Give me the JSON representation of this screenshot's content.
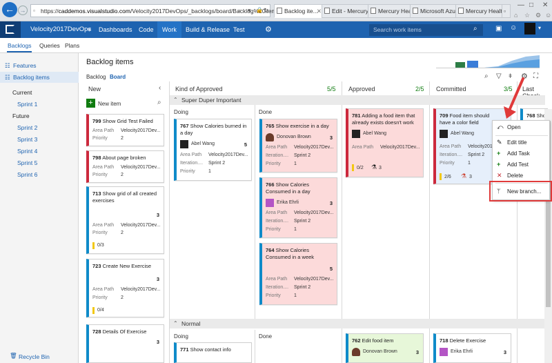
{
  "browser": {
    "url_prefix": "https://",
    "url_host": "caddemos.visualstudio.com",
    "url_path": "/Velocity2017DevOps/_backlogs/board/Backlog%20items",
    "tabs": [
      "Backlog ite...",
      "Edit - Mercury ...",
      "Mercury Healt...",
      "Microsoft Azur...",
      "Mercury Healt..."
    ],
    "window_controls": [
      "—",
      "□",
      "✕"
    ]
  },
  "topnav": {
    "project": "Velocity2017DevOps",
    "items": [
      "Dashboards",
      "Code",
      "Work",
      "Build & Release",
      "Test"
    ],
    "search_placeholder": "Search work items"
  },
  "subnav": {
    "items": [
      "Backlogs",
      "Queries",
      "Plans"
    ]
  },
  "left": {
    "features": "Features",
    "backlog_items": "Backlog items",
    "current": "Current",
    "sprint1": "Sprint 1",
    "future": "Future",
    "future_sprints": [
      "Sprint 2",
      "Sprint 3",
      "Sprint 4",
      "Sprint 5",
      "Sprint 6"
    ],
    "recycle_bin": "Recycle Bin"
  },
  "board": {
    "title": "Backlog items",
    "view_tabs": [
      "Backlog",
      "Board"
    ],
    "columns": [
      {
        "name": "New"
      },
      {
        "name": "Kind of Approved",
        "count": "5/5"
      },
      {
        "name": "Approved",
        "count": "2/5"
      },
      {
        "name": "Committed",
        "count": "3/5"
      },
      {
        "name": "Last Check"
      }
    ],
    "new_item": "New item",
    "swimlanes": [
      "Super Duper Important",
      "Normal"
    ],
    "lanes": [
      "Doing",
      "Done"
    ]
  },
  "labels": {
    "area": "Area Path",
    "priority": "Priority",
    "iteration": "Iteration...."
  },
  "cards": {
    "c799": {
      "id": "799",
      "title": "Show Grid Test Failed",
      "area": "Velocity2017Dev...",
      "priority": "2"
    },
    "c798": {
      "id": "798",
      "title": "About page broken",
      "area": "Velocity2017Dev...",
      "priority": "2"
    },
    "c713": {
      "id": "713",
      "title": "Show grid of all created exercises",
      "est": "3",
      "area": "Velocity2017Dev...",
      "priority": "2",
      "tasks": "0/3"
    },
    "c723": {
      "id": "723",
      "title": "Create New Exercise",
      "est": "3",
      "area": "Velocity2017Dev...",
      "priority": "2",
      "tasks": "0/4"
    },
    "c728": {
      "id": "728",
      "title": "Details Of Exercise",
      "est": "3"
    },
    "c767": {
      "id": "767",
      "title": "Show Calories burned in a day",
      "user": "Abel Wang",
      "est": "5",
      "area": "Velocity2017Dev...",
      "iteration": "Sprint 2",
      "priority": "1"
    },
    "c765": {
      "id": "765",
      "title": "Show exercise in a day",
      "user": "Donovan Brown",
      "est": "3",
      "area": "Velocity2017Dev...",
      "iteration": "Sprint 2",
      "priority": "1"
    },
    "c766": {
      "id": "766",
      "title": "Show Calories Consumed in a day",
      "user": "Erika Ehrli",
      "est": "3",
      "area": "Velocity2017Dev...",
      "iteration": "Sprint 2",
      "priority": "1"
    },
    "c764": {
      "id": "764",
      "title": "Show Calories Consumed in a week",
      "est": "5",
      "area": "Velocity2017Dev...",
      "iteration": "Sprint 2",
      "priority": "1"
    },
    "c781": {
      "id": "781",
      "title": "Adding a food item that already exists doesn't work",
      "user": "Abel Wang",
      "area": "Velocity2017Dev...",
      "tasks": "0/2",
      "tests": "3"
    },
    "c709": {
      "id": "709",
      "title": "Food item should have a color field",
      "user": "Abel Wang",
      "area": "Velocity2017D",
      "iteration": "Sprint 2",
      "priority": "1",
      "tasks": "2/6",
      "tests": "3"
    },
    "c768": {
      "id": "768",
      "title": "Show"
    },
    "c771": {
      "id": "771",
      "title": "Show contact info"
    },
    "c762": {
      "id": "762",
      "title": "Edit food item",
      "user": "Donovan Brown",
      "est": "3"
    },
    "c718": {
      "id": "718",
      "title": "Delete Exercise",
      "user": "Erika Ehrli",
      "est": "3"
    }
  },
  "menu": {
    "items": [
      "Open",
      "Edit title",
      "Add Task",
      "Add Test",
      "Delete",
      "New branch..."
    ]
  },
  "colors": {
    "accent": "#1e63b0",
    "bug": "#cc293d",
    "pbi": "#0f8bc9",
    "highlight": "#e03a3a"
  }
}
